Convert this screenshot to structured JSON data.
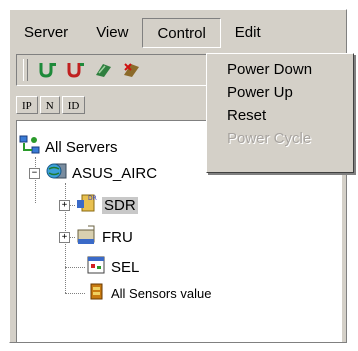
{
  "menubar": {
    "items": [
      "Server",
      "View",
      "Control",
      "Edit"
    ]
  },
  "control_menu": {
    "items": [
      {
        "label": "Power Down",
        "enabled": true
      },
      {
        "label": "Power Up",
        "enabled": true
      },
      {
        "label": "Reset",
        "enabled": true
      },
      {
        "label": "Power Cycle",
        "enabled": false
      }
    ]
  },
  "tabs": [
    "IP",
    "N",
    "ID"
  ],
  "toolbar": {
    "icons": [
      "connect-icon",
      "disconnect-icon",
      "refresh-icon",
      "stop-icon"
    ]
  },
  "tree": {
    "root": "All Servers",
    "server": "ASUS_AIRC",
    "children": [
      "SDR",
      "FRU",
      "SEL",
      "All Sensors value"
    ],
    "expander": "+",
    "collapser": "−"
  },
  "colors": {
    "window_bg": "#d4d0c8",
    "tree_bg": "#ffffff",
    "selection_bg": "#c8c8c8",
    "disabled_text": "#a8a4a0"
  }
}
